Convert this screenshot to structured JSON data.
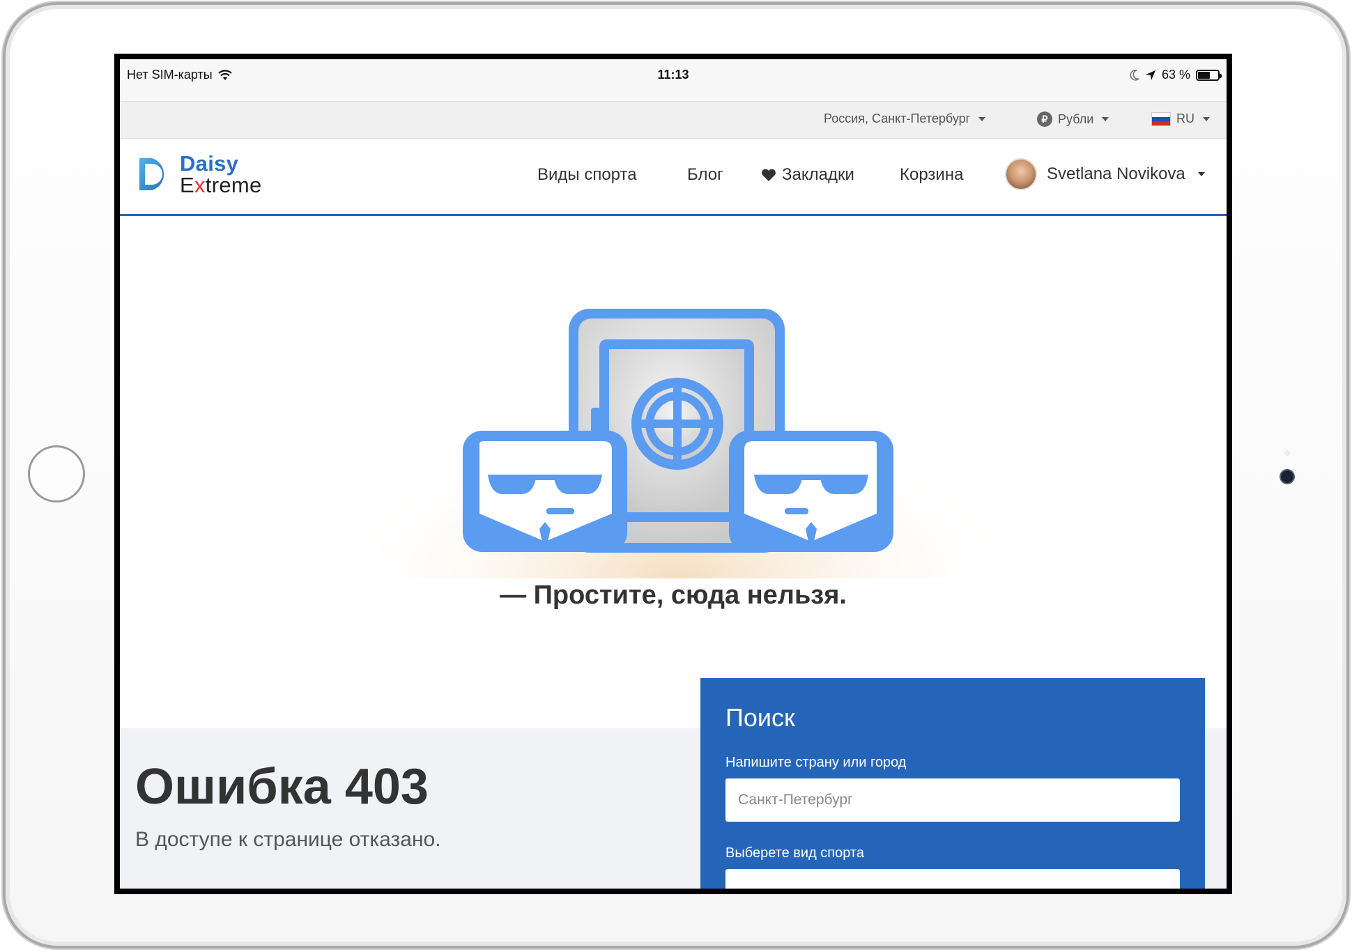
{
  "status_bar": {
    "carrier": "Нет SIM-карты",
    "time": "11:13",
    "battery": "63 %",
    "battery_level": 0.63
  },
  "topbar": {
    "location": "Россия, Санкт-Петербург",
    "currency": "Рубли",
    "currency_icon": "₽",
    "language": "RU"
  },
  "logo": {
    "line1": "Daisy",
    "line2_pre": "E",
    "line2_x": "x",
    "line2_post": "treme"
  },
  "nav": {
    "items": [
      "Виды спорта",
      "Блог",
      "Закладки",
      "Корзина"
    ],
    "user_name": "Svetlana Novikova"
  },
  "main": {
    "apology": "— Простите, сюда нельзя."
  },
  "error": {
    "title": "Ошибка 403",
    "subtitle": "В доступе к странице отказано."
  },
  "search": {
    "title": "Поиск",
    "location_label": "Напишите страну или город",
    "location_placeholder": "Санкт-Петербург",
    "sport_label": "Выберете вид спорта"
  },
  "colors": {
    "brand_blue": "#2565b9",
    "illustration_blue": "#5b9bf0",
    "logo_blue": "#2c6fc2",
    "logo_red": "#e2312f"
  }
}
